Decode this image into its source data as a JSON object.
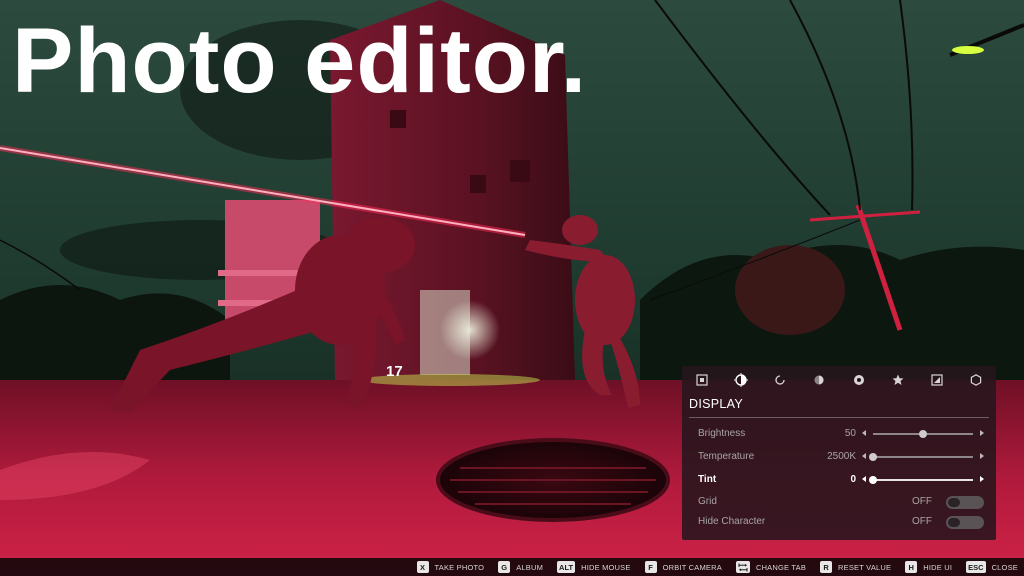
{
  "headline": "Photo editor.",
  "scene": {
    "description_icon": "night-street-scene",
    "counter": "17"
  },
  "colors": {
    "accent": "#ff2a55",
    "panel_bg": "#26161c",
    "text_primary": "#ffffff",
    "text_muted": "#a8a4a6"
  },
  "panel": {
    "tabs": [
      {
        "icon": "camera-frame-icon",
        "active": false
      },
      {
        "icon": "exposure-icon",
        "active": true
      },
      {
        "icon": "lens-icon",
        "active": false
      },
      {
        "icon": "color-filter-icon",
        "active": false
      },
      {
        "icon": "aperture-icon",
        "active": false
      },
      {
        "icon": "star-icon",
        "active": false
      },
      {
        "icon": "frame-border-icon",
        "active": false
      },
      {
        "icon": "hexagon-icon",
        "active": false
      }
    ],
    "section_title": "DISPLAY",
    "rows": [
      {
        "label": "Brightness",
        "value": "50",
        "slider_fraction": 0.5,
        "type": "slider",
        "selected": false
      },
      {
        "label": "Temperature",
        "value": "2500K",
        "slider_fraction": 0.0,
        "type": "slider",
        "selected": false
      },
      {
        "label": "Tint",
        "value": "0",
        "slider_fraction": 0.0,
        "type": "slider",
        "selected": true
      },
      {
        "label": "Grid",
        "value": "OFF",
        "type": "toggle",
        "selected": false
      },
      {
        "label": "Hide Character",
        "value": "OFF",
        "type": "toggle",
        "selected": false
      }
    ]
  },
  "hints": [
    {
      "key": "X",
      "label": "TAKE PHOTO"
    },
    {
      "key": "G",
      "label": "ALBUM"
    },
    {
      "key": "ALT",
      "label": "HIDE MOUSE"
    },
    {
      "key": "F",
      "label": "ORBIT CAMERA"
    },
    {
      "key": "",
      "key_icon": "tab-key-icon",
      "label": "CHANGE TAB"
    },
    {
      "key": "R",
      "label": "RESET VALUE"
    },
    {
      "key": "H",
      "label": "HIDE UI"
    },
    {
      "key": "ESC",
      "label": "CLOSE"
    }
  ]
}
